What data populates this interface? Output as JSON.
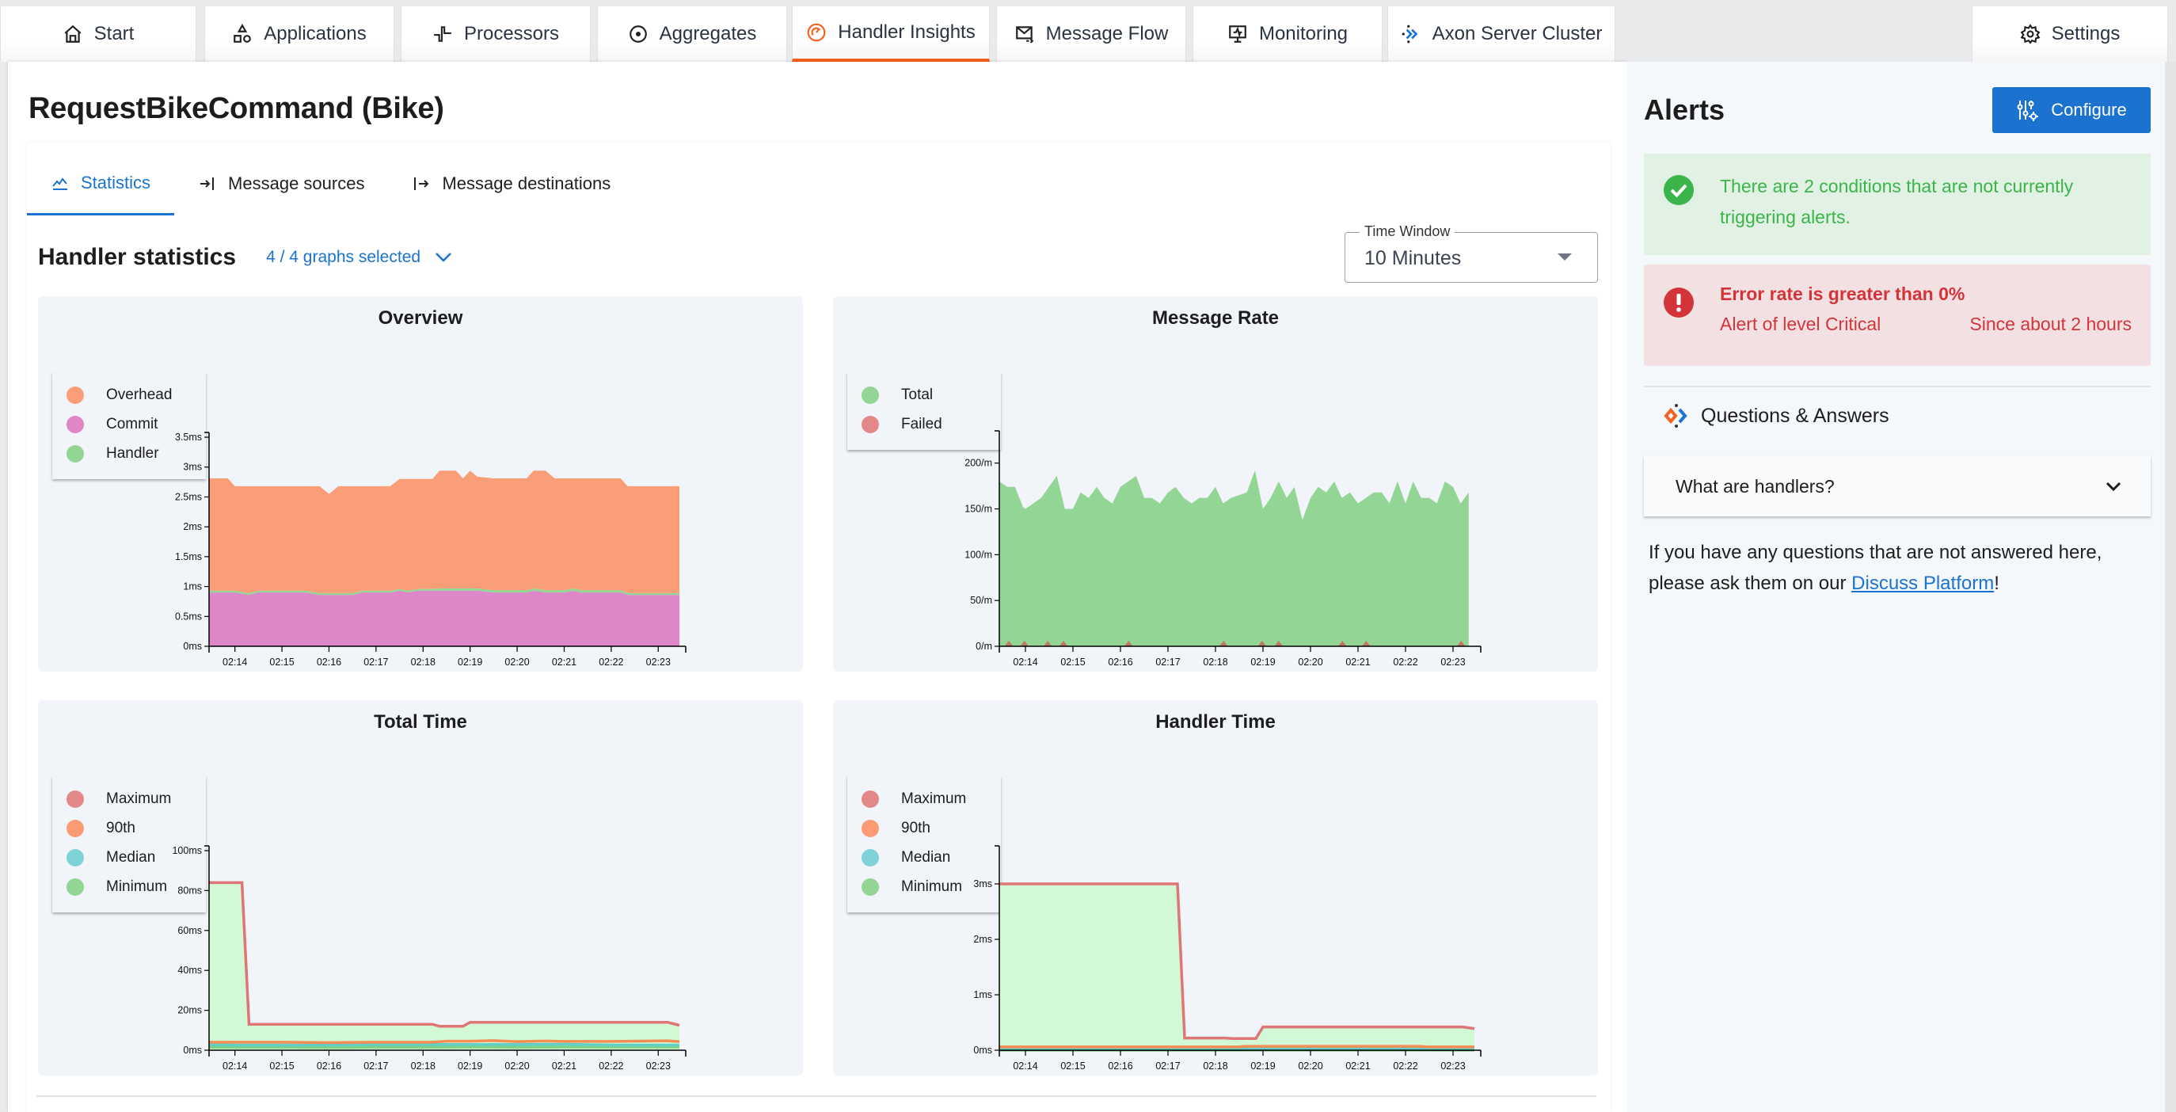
{
  "nav": {
    "tabs": [
      {
        "label": "Start",
        "icon": "home-icon",
        "active": false
      },
      {
        "label": "Applications",
        "icon": "shapes-icon",
        "active": false
      },
      {
        "label": "Processors",
        "icon": "processor-icon",
        "active": false
      },
      {
        "label": "Aggregates",
        "icon": "target-icon",
        "active": false
      },
      {
        "label": "Handler Insights",
        "icon": "gauge-icon",
        "active": true
      },
      {
        "label": "Message Flow",
        "icon": "mail-flow-icon",
        "active": false
      },
      {
        "label": "Monitoring",
        "icon": "monitor-icon",
        "active": false
      },
      {
        "label": "Axon Server Cluster",
        "icon": "axon-logo-icon",
        "active": false
      }
    ],
    "settings_label": "Settings",
    "active_color": "#f5611e"
  },
  "page": {
    "title": "RequestBikeCommand (Bike)",
    "subtabs": [
      {
        "label": "Statistics",
        "icon": "chart-line-icon",
        "active": true
      },
      {
        "label": "Message sources",
        "icon": "arrow-to-bar-icon",
        "active": false
      },
      {
        "label": "Message destinations",
        "icon": "bar-to-arrow-icon",
        "active": false
      }
    ],
    "stats_title": "Handler statistics",
    "graphs_selected": "4 / 4 graphs selected",
    "time_window": {
      "label": "Time Window",
      "value": "10 Minutes"
    }
  },
  "alerts": {
    "title": "Alerts",
    "configure_label": "Configure",
    "ok_message": "There are 2 conditions that are not currently triggering alerts.",
    "critical": {
      "title": "Error rate is greater than 0%",
      "level": "Alert of level Critical",
      "since": "Since about 2 hours"
    },
    "qa_title": "Questions & Answers",
    "qa_items": [
      {
        "question": "What are handlers?"
      }
    ],
    "qa_footer_before": "If you have any questions that are not answered here, please ask them on our ",
    "qa_footer_link": "Discuss Platform",
    "qa_footer_after": "!"
  },
  "chart_data": [
    {
      "id": "overview",
      "type": "area",
      "stacked": true,
      "title": "Overview",
      "ylabel": "",
      "xlabel": "",
      "ylim": [
        0,
        3.5
      ],
      "yticks": [
        0,
        0.5,
        1,
        1.5,
        2,
        2.5,
        3,
        3.5
      ],
      "ytick_labels": [
        "0ms",
        "0.5ms",
        "1ms",
        "1.5ms",
        "2ms",
        "2.5ms",
        "3ms",
        "3.5ms"
      ],
      "xlim": [
        13.45,
        23.45
      ],
      "xticks": [
        14,
        15,
        16,
        17,
        18,
        19,
        20,
        21,
        22,
        23
      ],
      "xtick_labels": [
        "02:14",
        "02:15",
        "02:16",
        "02:17",
        "02:18",
        "02:19",
        "02:20",
        "02:21",
        "02:22",
        "02:23"
      ],
      "x": [
        13.45,
        13.85,
        14.0,
        14.3,
        14.5,
        15.0,
        15.5,
        15.8,
        16.0,
        16.2,
        16.5,
        16.7,
        17.0,
        17.3,
        17.5,
        17.7,
        17.85,
        18.0,
        18.2,
        18.35,
        18.5,
        18.7,
        18.85,
        19.0,
        19.15,
        19.5,
        20.0,
        20.2,
        20.35,
        20.6,
        20.8,
        21.0,
        21.2,
        21.35,
        21.5,
        22.0,
        22.2,
        22.35,
        22.5,
        23.0,
        23.45
      ],
      "series": [
        {
          "name": "Commit",
          "color": "#de87c8",
          "values": [
            0.9,
            0.9,
            0.9,
            0.86,
            0.9,
            0.9,
            0.9,
            0.86,
            0.86,
            0.86,
            0.86,
            0.9,
            0.9,
            0.9,
            0.93,
            0.9,
            0.93,
            0.93,
            0.93,
            0.93,
            0.93,
            0.93,
            0.93,
            0.93,
            0.93,
            0.9,
            0.9,
            0.9,
            0.93,
            0.9,
            0.9,
            0.9,
            0.93,
            0.9,
            0.9,
            0.9,
            0.9,
            0.86,
            0.86,
            0.86,
            0.86
          ]
        },
        {
          "name": "Handler",
          "color": "#93d595",
          "values": [
            0.03,
            0.03,
            0.03,
            0.03,
            0.03,
            0.03,
            0.03,
            0.03,
            0.03,
            0.03,
            0.03,
            0.03,
            0.03,
            0.03,
            0.03,
            0.03,
            0.03,
            0.03,
            0.03,
            0.04,
            0.04,
            0.04,
            0.04,
            0.04,
            0.04,
            0.04,
            0.04,
            0.04,
            0.04,
            0.04,
            0.04,
            0.04,
            0.04,
            0.04,
            0.04,
            0.04,
            0.04,
            0.03,
            0.03,
            0.03,
            0.03
          ]
        },
        {
          "name": "Overhead",
          "color": "#fa9e78",
          "values": [
            1.88,
            1.88,
            1.75,
            1.79,
            1.75,
            1.75,
            1.75,
            1.79,
            1.66,
            1.79,
            1.79,
            1.75,
            1.75,
            1.75,
            1.84,
            1.87,
            1.84,
            1.84,
            1.84,
            1.97,
            1.97,
            1.97,
            1.84,
            1.97,
            1.87,
            1.87,
            1.87,
            1.87,
            1.97,
            2.0,
            1.87,
            1.87,
            1.84,
            1.87,
            1.87,
            1.87,
            1.87,
            1.79,
            1.79,
            1.79,
            1.79
          ]
        }
      ],
      "legend": [
        "Overhead",
        "Commit",
        "Handler"
      ],
      "legend_colors": [
        "#fa9e78",
        "#de87c8",
        "#93d595"
      ],
      "legend_position": "left"
    },
    {
      "id": "message-rate",
      "type": "area",
      "title": "Message Rate",
      "ylim": [
        0,
        230
      ],
      "yticks": [
        0,
        50,
        100,
        150,
        200
      ],
      "ytick_labels": [
        "0/m",
        "50/m",
        "100/m",
        "150/m",
        "200/m"
      ],
      "xlim": [
        13.45,
        23.45
      ],
      "xticks": [
        14,
        15,
        16,
        17,
        18,
        19,
        20,
        21,
        22,
        23
      ],
      "xtick_labels": [
        "02:14",
        "02:15",
        "02:16",
        "02:17",
        "02:18",
        "02:19",
        "02:20",
        "02:21",
        "02:22",
        "02:23"
      ],
      "series": [
        {
          "name": "Total",
          "color": "#93d595",
          "x": [
            13.45,
            13.62,
            13.78,
            13.95,
            14.0,
            14.33,
            14.66,
            14.83,
            15.0,
            15.16,
            15.33,
            15.5,
            15.66,
            15.83,
            16.0,
            16.33,
            16.5,
            16.66,
            16.83,
            17.0,
            17.16,
            17.33,
            17.5,
            17.66,
            17.83,
            18.0,
            18.16,
            18.33,
            18.66,
            18.83,
            19.0,
            19.16,
            19.33,
            19.5,
            19.66,
            19.83,
            20.0,
            20.16,
            20.33,
            20.5,
            20.66,
            20.83,
            21.0,
            21.33,
            21.5,
            21.66,
            21.83,
            22.0,
            22.16,
            22.33,
            22.5,
            22.66,
            22.83,
            23.0,
            23.16,
            23.33
          ],
          "values": [
            180,
            174,
            174,
            152,
            150,
            162,
            186,
            150,
            150,
            168,
            162,
            174,
            162,
            156,
            174,
            186,
            162,
            162,
            156,
            168,
            174,
            162,
            156,
            162,
            162,
            174,
            156,
            162,
            168,
            192,
            150,
            162,
            180,
            162,
            174,
            138,
            162,
            174,
            168,
            180,
            162,
            168,
            156,
            168,
            168,
            156,
            180,
            156,
            180,
            162,
            162,
            156,
            180,
            174,
            156,
            168
          ]
        },
        {
          "name": "Failed",
          "color": "#c0775f",
          "spikes_at": [
            13.65,
            13.98,
            14.47,
            14.8,
            16.17,
            18.17,
            18.98,
            19.33,
            20.67,
            21.17,
            23.17
          ],
          "spike_value": 6
        }
      ],
      "legend": [
        "Total",
        "Failed"
      ],
      "legend_colors": [
        "#93d595",
        "#e38888"
      ],
      "legend_position": "left"
    },
    {
      "id": "total-time",
      "type": "line",
      "title": "Total Time",
      "ylim": [
        0,
        100
      ],
      "yticks": [
        0,
        20,
        40,
        60,
        80,
        100
      ],
      "ytick_labels": [
        "0ms",
        "20ms",
        "40ms",
        "60ms",
        "80ms",
        "100ms"
      ],
      "xlim": [
        13.45,
        23.45
      ],
      "xticks": [
        14,
        15,
        16,
        17,
        18,
        19,
        20,
        21,
        22,
        23
      ],
      "xtick_labels": [
        "02:14",
        "02:15",
        "02:16",
        "02:17",
        "02:18",
        "02:19",
        "02:20",
        "02:21",
        "02:22",
        "02:23"
      ],
      "series": [
        {
          "name": "Maximum",
          "color": "#e07575",
          "fill": "#d2f9d5",
          "x": [
            13.45,
            14.15,
            14.3,
            18.2,
            18.35,
            18.85,
            19.0,
            23.2,
            23.45
          ],
          "values": [
            84,
            84,
            13,
            13,
            12,
            12,
            14,
            14,
            12.5
          ]
        },
        {
          "name": "90th",
          "color": "#f58d55",
          "x": [
            13.45,
            15.0,
            16.0,
            17.0,
            18.2,
            18.5,
            19.0,
            19.5,
            20.0,
            20.6,
            21.0,
            22.0,
            23.2,
            23.45
          ],
          "values": [
            4,
            4,
            3.8,
            4,
            4,
            4.5,
            4.5,
            4.8,
            4.3,
            4.6,
            4.4,
            4.4,
            4.7,
            4.3
          ]
        },
        {
          "name": "Median",
          "color": "#5fcfc7",
          "x": [
            13.45,
            14.0,
            15.0,
            16.0,
            17.0,
            18.0,
            19.0,
            20.0,
            21.0,
            22.0,
            23.45
          ],
          "values": [
            2.9,
            2.6,
            2.6,
            2.6,
            2.9,
            2.9,
            2.9,
            2.9,
            3.0,
            2.6,
            2.6
          ]
        },
        {
          "name": "Minimum",
          "color": "#7ed084",
          "x": [
            13.45,
            14.0,
            15.0,
            16.0,
            17.0,
            18.0,
            19.0,
            20.0,
            21.0,
            22.0,
            23.45
          ],
          "values": [
            1.5,
            1.5,
            1.5,
            1.4,
            1.5,
            1.5,
            1.6,
            1.5,
            1.6,
            1.6,
            1.6
          ]
        }
      ],
      "legend": [
        "Maximum",
        "90th",
        "Median",
        "Minimum"
      ],
      "legend_colors": [
        "#e38888",
        "#fc9b73",
        "#80d2d9",
        "#93d595"
      ],
      "legend_position": "left"
    },
    {
      "id": "handler-time",
      "type": "line",
      "title": "Handler Time",
      "ylim": [
        0,
        3.6
      ],
      "yticks": [
        0,
        1,
        2,
        3
      ],
      "ytick_labels": [
        "0ms",
        "1ms",
        "2ms",
        "3ms"
      ],
      "xlim": [
        13.45,
        23.45
      ],
      "xticks": [
        14,
        15,
        16,
        17,
        18,
        19,
        20,
        21,
        22,
        23
      ],
      "xtick_labels": [
        "02:14",
        "02:15",
        "02:16",
        "02:17",
        "02:18",
        "02:19",
        "02:20",
        "02:21",
        "02:22",
        "02:23"
      ],
      "series": [
        {
          "name": "Maximum",
          "color": "#e07575",
          "fill": "#d2f9d5",
          "x": [
            13.45,
            17.2,
            17.35,
            18.2,
            18.35,
            18.85,
            19.0,
            23.2,
            23.45
          ],
          "values": [
            3.0,
            3.0,
            0.22,
            0.22,
            0.21,
            0.21,
            0.42,
            0.42,
            0.39
          ]
        },
        {
          "name": "90th",
          "color": "#f58d55",
          "x": [
            13.45,
            18.5,
            18.6,
            22.3,
            22.45,
            23.45
          ],
          "values": [
            0.06,
            0.06,
            0.07,
            0.07,
            0.06,
            0.06
          ]
        },
        {
          "name": "Median",
          "color": "#5fcfc7",
          "x": [
            13.45,
            23.45
          ],
          "values": [
            0.03,
            0.03
          ]
        },
        {
          "name": "Minimum",
          "color": "#3c9a43",
          "x": [
            13.45,
            23.45
          ],
          "values": [
            0.005,
            0.005
          ]
        }
      ],
      "legend": [
        "Maximum",
        "90th",
        "Median",
        "Minimum"
      ],
      "legend_colors": [
        "#e38888",
        "#fc9b73",
        "#80d2d9",
        "#93d595"
      ],
      "legend_position": "left"
    }
  ]
}
